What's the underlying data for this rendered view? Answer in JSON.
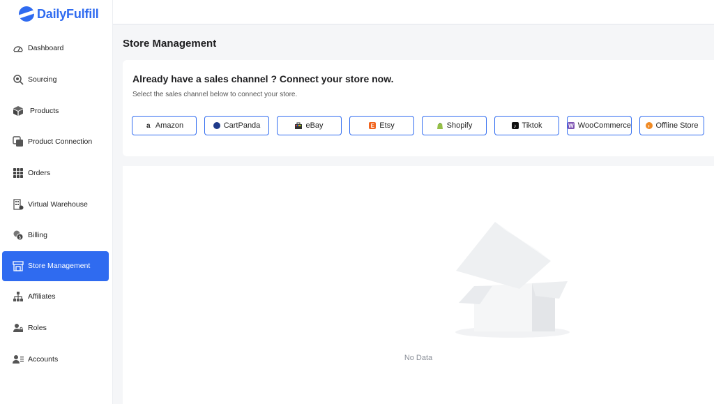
{
  "brand": {
    "name": "DailyFulfill",
    "color": "#2f6bf0"
  },
  "sidebar": {
    "items": [
      {
        "label": "Dashboard",
        "icon": "dashboard-gauge-icon"
      },
      {
        "label": "Sourcing",
        "icon": "search-icon"
      },
      {
        "label": "Products",
        "icon": "box-icon"
      },
      {
        "label": "Product Connection",
        "icon": "link-copy-icon"
      },
      {
        "label": "Orders",
        "icon": "grid-icon"
      },
      {
        "label": "Virtual Warehouse",
        "icon": "building-icon"
      },
      {
        "label": "Billing",
        "icon": "coins-icon"
      },
      {
        "label": "Store Management",
        "icon": "store-icon",
        "active": true
      },
      {
        "label": "Affiliates",
        "icon": "network-icon"
      },
      {
        "label": "Roles",
        "icon": "user-lock-icon"
      },
      {
        "label": "Accounts",
        "icon": "user-list-icon"
      }
    ]
  },
  "page": {
    "title": "Store Management"
  },
  "connect": {
    "title": "Already have a sales channel ? Connect your store now.",
    "subtitle": "Select the sales channel below to connect your store.",
    "channels": [
      {
        "label": "Amazon",
        "icon": "amazon-icon",
        "color": "#222222"
      },
      {
        "label": "CartPanda",
        "icon": "cartpanda-icon",
        "color": "#1e3a8a"
      },
      {
        "label": "eBay",
        "icon": "ebay-icon",
        "color": "#e53238"
      },
      {
        "label": "Etsy",
        "icon": "etsy-icon",
        "color": "#f1641e"
      },
      {
        "label": "Shopify",
        "icon": "shopify-icon",
        "color": "#95bf47"
      },
      {
        "label": "Tiktok",
        "icon": "tiktok-icon",
        "color": "#111111"
      },
      {
        "label": "WooCommerce",
        "icon": "woocommerce-icon",
        "color": "#7f54b3"
      },
      {
        "label": "Offline Store",
        "icon": "offline-store-icon",
        "color": "#f08a24"
      }
    ]
  },
  "empty": {
    "text": "No Data",
    "icon": "empty-box-icon"
  }
}
